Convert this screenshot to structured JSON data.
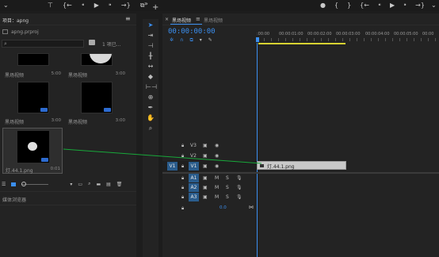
{
  "colors": {
    "accent": "#2d8ceb",
    "timecode": "#3b8ff0",
    "workarea": "#d7d232",
    "drag_line": "#18a83a",
    "clip": "#c9c9c9"
  },
  "transport_left": [
    "⊤",
    "{←",
    "⁌",
    "▶",
    "⁍",
    "→}",
    "⧉",
    "»",
    "+"
  ],
  "transport_right": [
    "●",
    "{",
    "}",
    "{←",
    "⁌",
    "▶",
    "⁍",
    "→}"
  ],
  "project": {
    "tab": "项目：apng",
    "file": "apng.prproj",
    "search_placeholder": "",
    "item_count": "1 项已...",
    "items": [
      {
        "name": "黑场视频",
        "duration": "5:00"
      },
      {
        "name": "黑场视频",
        "duration": "3:00"
      },
      {
        "name": "黑场视频",
        "duration": "3:00"
      },
      {
        "name": "黑场视频",
        "duration": "3:00"
      },
      {
        "name": "灯.44.1.png",
        "duration": "0:01"
      }
    ],
    "bottom_tab": "媒体浏览器"
  },
  "timeline": {
    "tab_active": "黑场视频",
    "tab_menu": "≡",
    "tab_inactive": "黑场视频",
    "timecode": "00:00:00:00",
    "ruler": [
      ":00:00",
      "00:00:01:00",
      "00:00:02:00",
      "00:00:03:00",
      "00:00:04:00",
      "00:00:05:00",
      "00:00"
    ],
    "video_tracks": [
      {
        "source": "",
        "name": "V3"
      },
      {
        "source": "",
        "name": "V2"
      },
      {
        "source": "V1",
        "name": "V1"
      }
    ],
    "audio_tracks": [
      {
        "source": "A1",
        "name": "A1"
      },
      {
        "source": "A2",
        "name": "A2"
      },
      {
        "source": "A3",
        "name": "A3"
      }
    ],
    "mix_value": "0.0",
    "drag_clip": "灯.44.1.png"
  }
}
